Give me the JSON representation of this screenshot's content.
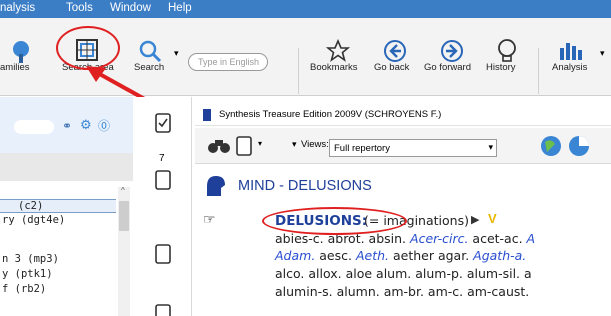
{
  "menu": {
    "analysis": "nalysis",
    "tools": "Tools",
    "window": "Window",
    "help": "Help"
  },
  "toolbar": {
    "families_label": "amilies",
    "search_area_label": "Search area",
    "search_label": "Search",
    "type_placeholder": "Type in English",
    "bookmarks_label": "Bookmarks",
    "go_back_label": "Go back",
    "go_forward_label": "Go forward",
    "history_label": "History",
    "analysis_label": "Analysis"
  },
  "left_panel": {
    "items": [
      "(c2)",
      "ry (dgt4e)",
      "n 3 (mp3)",
      "y (ptk1)",
      "f (rb2)"
    ]
  },
  "middle_strip": {
    "count": "7"
  },
  "document": {
    "window_title": "Synthesis Treasure Edition 2009V (SCHROYENS F.)",
    "views_label": "Views:",
    "views_value": "Full repertory",
    "rubric_title": "MIND - DELUSIONS",
    "rubric_head": "DELUSIONS:",
    "rubric_synonym": "(= imaginations)",
    "line1": [
      "abies-c. abrot. absin. ",
      "Acer-circ.",
      " acet-ac. ",
      "A"
    ],
    "line2": [
      "Adam.",
      " aesc. ",
      "Aeth.",
      " aether agar. ",
      "Agath-a.",
      " "
    ],
    "line3": "alco. allox. aloe alum. alum-p. alum-sil. a",
    "line4": "alumin-s. alumn. am-br. am-c. am-caust."
  },
  "colors": {
    "menubar": "#3c7ec6",
    "annotation": "#e02020",
    "rubric": "#1e3f9a",
    "italic_remedy": "#2a4fd0"
  }
}
